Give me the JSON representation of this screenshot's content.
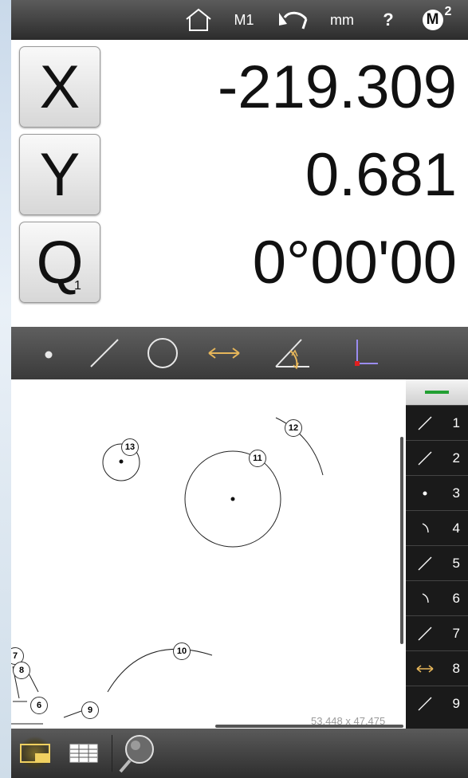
{
  "topbar": {
    "home_icon": "home-icon",
    "mode_label": "M1",
    "undo_icon": "undo-icon",
    "unit_label": "mm",
    "help_label": "?",
    "memory_badge": "M",
    "memory_superscript": "2"
  },
  "readout": {
    "x_label": "X",
    "x_value": "-219.309",
    "y_label": "Y",
    "y_value": "0.681",
    "q_label": "Q",
    "q_subscript": "1",
    "q_value": "0°00'00"
  },
  "toolbar": {
    "tools": [
      "point-tool-icon",
      "line-tool-icon",
      "circle-tool-icon",
      "distance-tool-icon",
      "angle-tool-icon",
      "datum-tool-icon"
    ],
    "accent": "#e6b65a"
  },
  "canvas": {
    "features": [
      {
        "label": "13"
      },
      {
        "label": "11"
      },
      {
        "label": "12"
      },
      {
        "label": "10"
      },
      {
        "label": "7"
      },
      {
        "label": "8"
      },
      {
        "label": "6"
      },
      {
        "label": "9"
      }
    ],
    "dimensions": "53.448 x 47.475"
  },
  "feature_list": {
    "header_accent": "#22a033",
    "items": [
      {
        "num": "1",
        "icon": "line-icon"
      },
      {
        "num": "2",
        "icon": "line-icon"
      },
      {
        "num": "3",
        "icon": "point-icon"
      },
      {
        "num": "4",
        "icon": "arc-icon"
      },
      {
        "num": "5",
        "icon": "line-icon"
      },
      {
        "num": "6",
        "icon": "arc-icon"
      },
      {
        "num": "7",
        "icon": "line-icon"
      },
      {
        "num": "8",
        "icon": "distance-icon"
      },
      {
        "num": "9",
        "icon": "line-icon"
      }
    ]
  },
  "bottombar": {
    "buttons": [
      "view-graphic-icon",
      "view-table-icon",
      "magnifier-icon"
    ]
  }
}
